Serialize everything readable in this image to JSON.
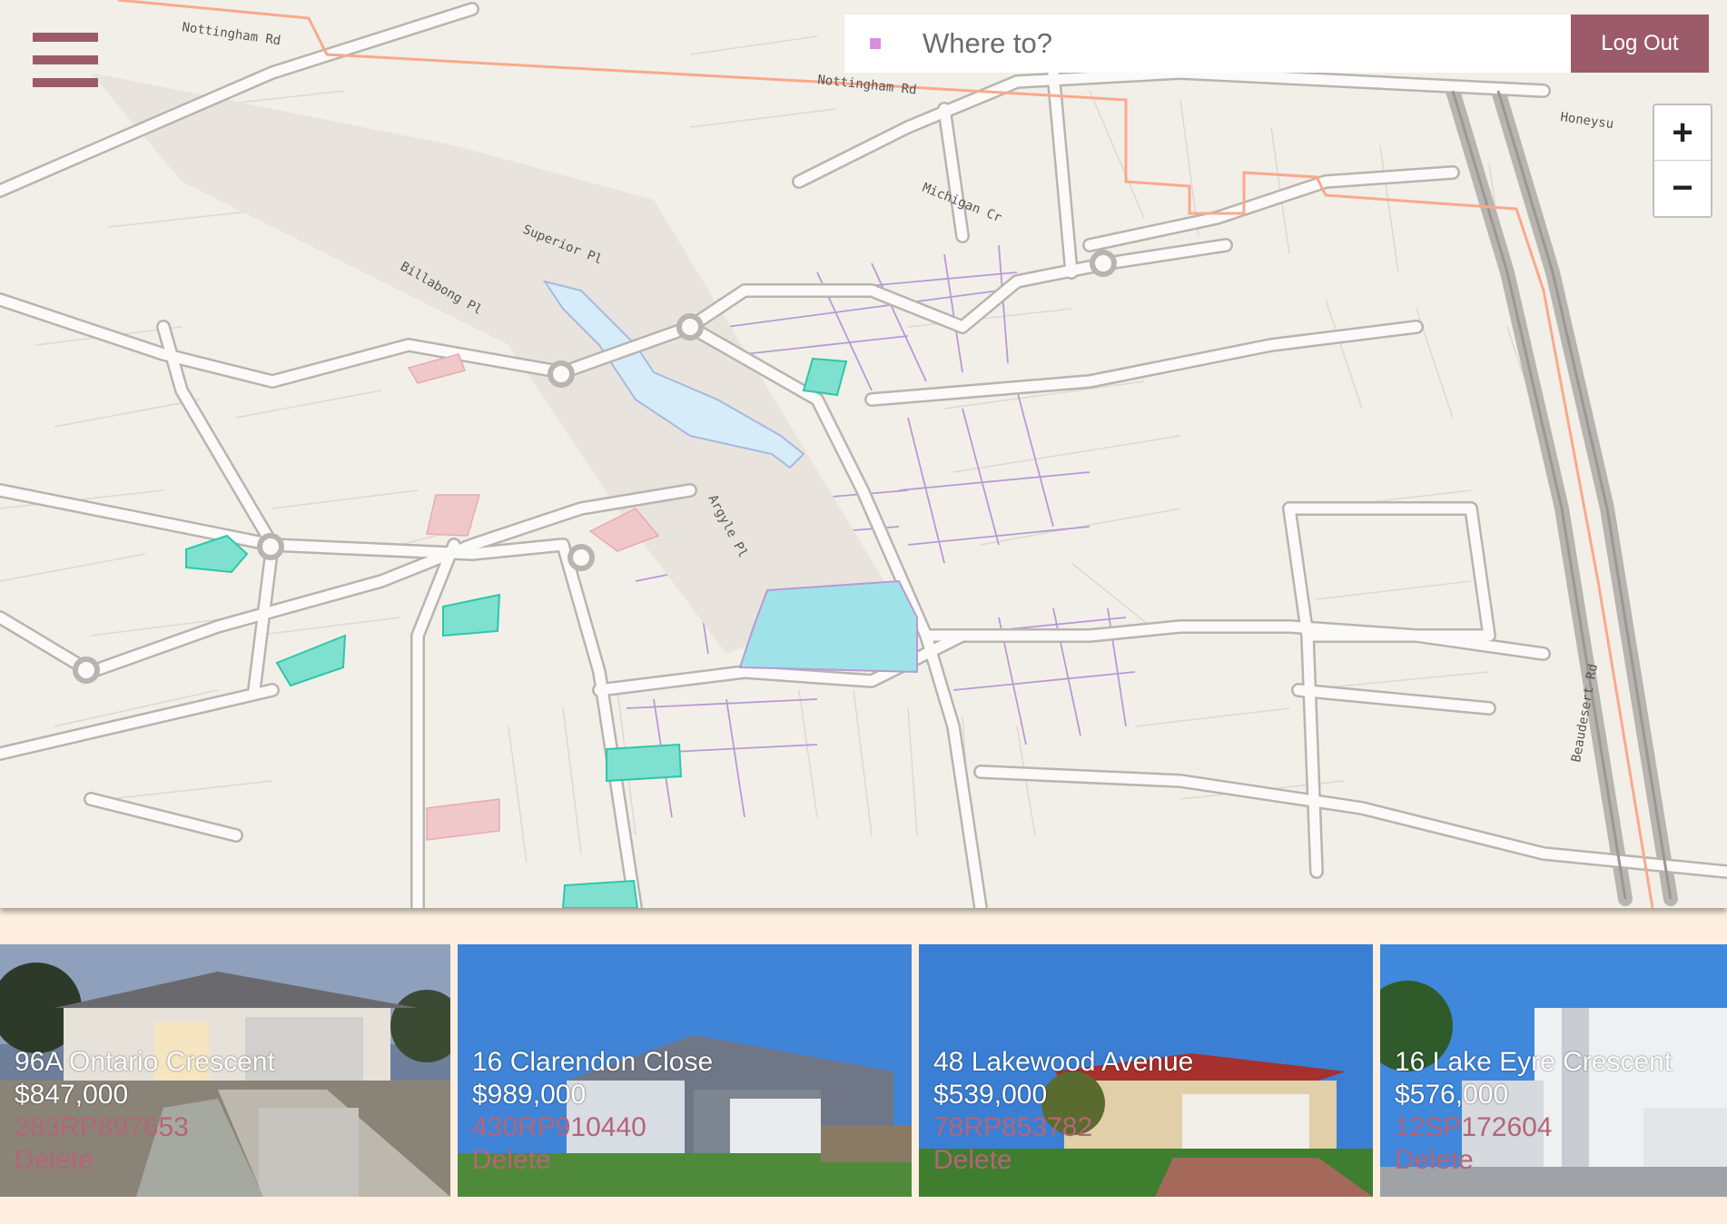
{
  "header": {
    "menu_icon": "hamburger-menu-icon",
    "search_placeholder": "Where to?",
    "logout_label": "Log Out"
  },
  "map": {
    "zoom_in_label": "+",
    "zoom_out_label": "−",
    "street_labels": {
      "nottingham_1": "Nottingham Rd",
      "nottingham_2": "Nottingham Rd",
      "superior": "Superior Pl",
      "billabong": "Billabong Pl",
      "michigan": "Michigan Cr",
      "argyle": "Argyle Pl",
      "beaudesert": "Beaudesert Rd",
      "honeysuckle": "Honeysu"
    },
    "colors": {
      "background": "#f2efe9",
      "road": "#c9c6c0",
      "highlight_parcel": "#7fe0cf",
      "red_parcel": "#f0b9bd",
      "water": "#d6ecf8",
      "boundary": "#f9a98c"
    }
  },
  "listings": [
    {
      "address": "96A Ontario Crescent",
      "price": "$847,000",
      "ref": "283RP897653",
      "delete_label": "Delete"
    },
    {
      "address": "16 Clarendon Close",
      "price": "$989,000",
      "ref": "430RP910440",
      "delete_label": "Delete"
    },
    {
      "address": "48 Lakewood Avenue",
      "price": "$539,000",
      "ref": "78RP853782",
      "delete_label": "Delete"
    },
    {
      "address": "16 Lake Eyre Crescent",
      "price": "$576,000",
      "ref": "12SP172604",
      "delete_label": "Delete"
    }
  ]
}
